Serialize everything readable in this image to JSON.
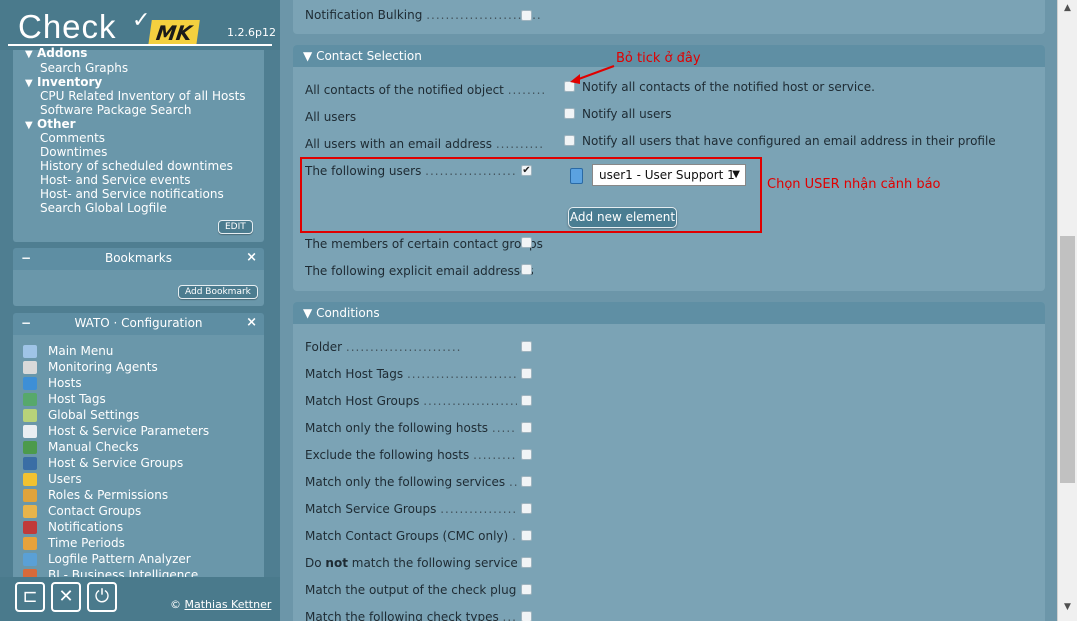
{
  "brand": {
    "logo_text": "Check",
    "logo_mark": "✓",
    "logo_mk": "MK",
    "version": "1.2.6p12"
  },
  "views": {
    "addons_label": "Addons",
    "rows": [
      {
        "type": "item",
        "label": "Search Graphs"
      },
      {
        "type": "cat",
        "label": "Inventory"
      },
      {
        "type": "item",
        "label": "CPU Related Inventory of all Hosts"
      },
      {
        "type": "item",
        "label": "Software Package Search"
      },
      {
        "type": "cat",
        "label": "Other"
      },
      {
        "type": "item",
        "label": "Comments"
      },
      {
        "type": "item",
        "label": "Downtimes"
      },
      {
        "type": "item",
        "label": "History of scheduled downtimes"
      },
      {
        "type": "item",
        "label": "Host- and Service events"
      },
      {
        "type": "item",
        "label": "Host- and Service notifications"
      },
      {
        "type": "item",
        "label": "Search Global Logfile"
      }
    ],
    "edit_label": "EDIT"
  },
  "bookmarks": {
    "title": "Bookmarks",
    "minus": "−",
    "close": "×",
    "add_label": "Add Bookmark"
  },
  "wato": {
    "title": "WATO · Configuration",
    "minus": "−",
    "close": "×",
    "items": [
      {
        "label": "Main Menu",
        "icon": "home-icon",
        "color": "#9fc4e6"
      },
      {
        "label": "Monitoring Agents",
        "icon": "agent-icon",
        "color": "#d9d9d9"
      },
      {
        "label": "Hosts",
        "icon": "folder-icon",
        "color": "#3d8fd6"
      },
      {
        "label": "Host Tags",
        "icon": "tag-icon",
        "color": "#57a86b"
      },
      {
        "label": "Global Settings",
        "icon": "settings-icon",
        "color": "#b7d27a"
      },
      {
        "label": "Host & Service Parameters",
        "icon": "rules-icon",
        "color": "#e9eef2"
      },
      {
        "label": "Manual Checks",
        "icon": "check-icon",
        "color": "#4c9a4c"
      },
      {
        "label": "Host & Service Groups",
        "icon": "groups-icon",
        "color": "#3a6ea5"
      },
      {
        "label": "Users",
        "icon": "users-icon",
        "color": "#f2c230"
      },
      {
        "label": "Roles & Permissions",
        "icon": "roles-icon",
        "color": "#e0a33b"
      },
      {
        "label": "Contact Groups",
        "icon": "contact-groups-icon",
        "color": "#e8b44a"
      },
      {
        "label": "Notifications",
        "icon": "notifications-icon",
        "color": "#c03a3a"
      },
      {
        "label": "Time Periods",
        "icon": "clock-icon",
        "color": "#e8a23a"
      },
      {
        "label": "Logfile Pattern Analyzer",
        "icon": "analyzer-icon",
        "color": "#5aa0d6"
      },
      {
        "label": "BI - Business Intelligence",
        "icon": "bi-icon",
        "color": "#d96a3a"
      }
    ]
  },
  "footer": {
    "copyright_symbol": "©",
    "author": "Mathias Kettner"
  },
  "main": {
    "top_row": {
      "label": "Notification Bulking"
    },
    "contact_selection": {
      "title": "Contact Selection",
      "rows": [
        {
          "label": "All contacts of the notified object",
          "option": "Notify all contacts of the notified host or service.",
          "checked": false
        },
        {
          "label": "All users",
          "option": "Notify all users",
          "checked": false
        },
        {
          "label": "All users with an email address",
          "option": "Notify all users that have configured an email address in their profile",
          "checked": false
        },
        {
          "label": "The following users",
          "checked": true
        },
        {
          "label": "The members of certain contact groups",
          "checked": false
        },
        {
          "label": "The following explicit email addresses",
          "checked": false
        }
      ],
      "user_select_value": "user1 - User Support 1",
      "add_element_label": "Add new element"
    },
    "conditions": {
      "title": "Conditions",
      "rows": [
        {
          "label": "Folder"
        },
        {
          "label": "Match Host Tags"
        },
        {
          "label": "Match Host Groups"
        },
        {
          "label": "Match only the following hosts"
        },
        {
          "label": "Exclude the following hosts"
        },
        {
          "label": "Match only the following services"
        },
        {
          "label": "Match Service Groups"
        },
        {
          "label": "Match Contact Groups (CMC only)"
        },
        {
          "label_pre": "Do ",
          "label_bold": "not",
          "label_post": " match the following services"
        },
        {
          "label": "Match the output of the check plugin"
        },
        {
          "label": "Match the following check types"
        }
      ]
    }
  },
  "annotations": {
    "untick_here": "Bỏ tick ở đây",
    "choose_user": "Chọn USER nhận cảnh báo"
  },
  "dots": "........................"
}
